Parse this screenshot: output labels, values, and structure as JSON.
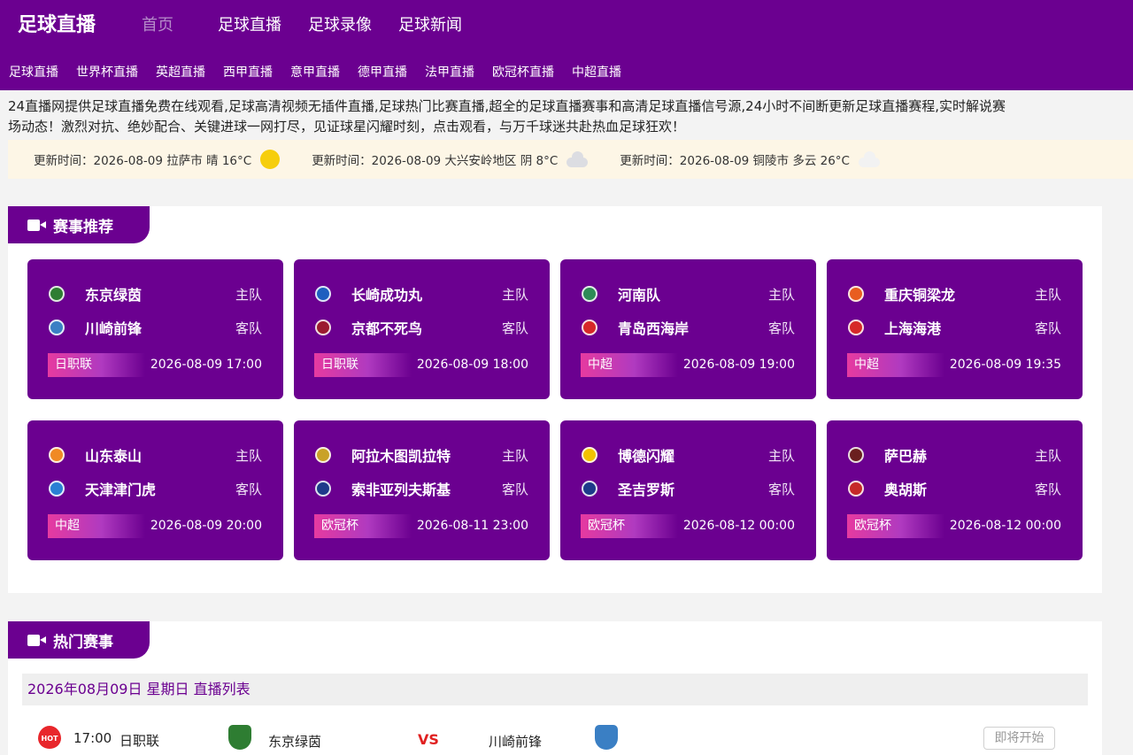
{
  "brand": "足球直播",
  "main_nav": [
    {
      "label": "首页",
      "current": true
    },
    {
      "label": "足球直播"
    },
    {
      "label": "足球录像"
    },
    {
      "label": "足球新闻"
    }
  ],
  "sub_nav": [
    "足球直播",
    "世界杯直播",
    "英超直播",
    "西甲直播",
    "意甲直播",
    "德甲直播",
    "法甲直播",
    "欧冠杯直播",
    "中超直播"
  ],
  "intro": {
    "line1": "24直播网提供足球直播免费在线观看,足球高清视频无插件直播,足球热门比赛直播,超全的足球直播赛事和高清足球直播信号源,24小时不间断更新足球直播赛程,实时解说赛",
    "line2": "场动态！激烈对抗、绝妙配合、关键进球一网打尽，见证球星闪耀时刻，点击观看，与万千球迷共赴热血足球狂欢！"
  },
  "weather": [
    {
      "text": "更新时间：2026-08-09 拉萨市 晴 16°C",
      "icon": "sun-icon"
    },
    {
      "text": "更新时间：2026-08-09 大兴安岭地区 阴 8°C",
      "icon": "cloud-icon"
    },
    {
      "text": "更新时间：2026-08-09 铜陵市 多云 26°C",
      "icon": "cloud-icon"
    }
  ],
  "featured": {
    "title": "赛事推荐",
    "home_role": "主队",
    "away_role": "客队",
    "matches": [
      {
        "home": "东京绿茵",
        "away": "川崎前锋",
        "league": "日职联",
        "time": "2026-08-09 17:00",
        "home_color": "#2e7d32",
        "away_color": "#3a7fc4"
      },
      {
        "home": "长崎成功丸",
        "away": "京都不死鸟",
        "league": "日职联",
        "time": "2026-08-09 18:00",
        "home_color": "#1e5fbf",
        "away_color": "#9b1b30"
      },
      {
        "home": "河南队",
        "away": "青岛西海岸",
        "league": "中超",
        "time": "2026-08-09 19:00",
        "home_color": "#2e8b57",
        "away_color": "#d62828"
      },
      {
        "home": "重庆铜梁龙",
        "away": "上海海港",
        "league": "中超",
        "time": "2026-08-09 19:35",
        "home_color": "#e85d20",
        "away_color": "#d62828"
      },
      {
        "home": "山东泰山",
        "away": "天津津门虎",
        "league": "中超",
        "time": "2026-08-09 20:00",
        "home_color": "#f08a24",
        "away_color": "#2a7fd4"
      },
      {
        "home": "阿拉木图凯拉特",
        "away": "索非亚列夫斯基",
        "league": "欧冠杯",
        "time": "2026-08-11 23:00",
        "home_color": "#c9a227",
        "away_color": "#1e3a8a"
      },
      {
        "home": "博德闪耀",
        "away": "圣吉罗斯",
        "league": "欧冠杯",
        "time": "2026-08-12 00:00",
        "home_color": "#f2c200",
        "away_color": "#1e3a8a"
      },
      {
        "home": "萨巴赫",
        "away": "奥胡斯",
        "league": "欧冠杯",
        "time": "2026-08-12 00:00",
        "home_color": "#6a1f1f",
        "away_color": "#c62828"
      }
    ]
  },
  "hot": {
    "title": "热门赛事",
    "date_header": "2026年08月09日 星期日 直播列表",
    "rows": [
      {
        "badge": "HOT",
        "time": "17:00",
        "league": "日职联",
        "home": "东京绿茵",
        "vs": "VS",
        "away": "川崎前锋",
        "status": "即将开始",
        "home_color": "#2e7d32",
        "away_color": "#3a7fc4"
      }
    ]
  },
  "colors": {
    "primary": "#6b0090",
    "accent": "#e63aa0",
    "vs": "#e02020",
    "weather_bg": "#fdf6e6"
  }
}
